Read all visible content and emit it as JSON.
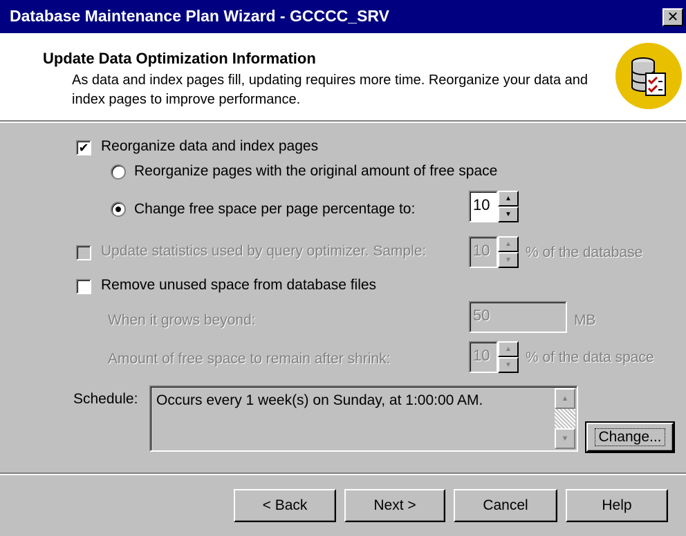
{
  "window": {
    "title": "Database Maintenance Plan Wizard - GCCCC_SRV",
    "close_glyph": "✕"
  },
  "header": {
    "title": "Update Data Optimization Information",
    "description": "As data and index pages fill, updating requires more time. Reorganize your data and index pages to improve performance.",
    "icon": "database-checklist-icon"
  },
  "options": {
    "reorganize": {
      "label": "Reorganize data and index pages",
      "checked": true,
      "enabled": true
    },
    "radio_original": {
      "label": "Reorganize pages with the original amount of free space",
      "selected": false
    },
    "radio_change": {
      "label": "Change free space per page percentage to:",
      "selected": true,
      "value": "10"
    },
    "update_stats": {
      "label": "Update statistics used by query optimizer. Sample:",
      "checked": false,
      "enabled": false,
      "value": "10",
      "suffix": "% of the database"
    },
    "remove_unused": {
      "label": "Remove unused space from database files",
      "checked": false,
      "enabled": true
    },
    "grows_beyond": {
      "label": "When it grows beyond:",
      "value": "50",
      "suffix": "MB",
      "enabled": false
    },
    "free_after_shrink": {
      "label": "Amount of free space to remain after shrink:",
      "value": "10",
      "suffix": "% of the data space",
      "enabled": false
    }
  },
  "schedule": {
    "label": "Schedule:",
    "text": "Occurs every 1 week(s) on Sunday, at 1:00:00 AM.",
    "change_label": "Change..."
  },
  "footer": {
    "back_label": "< Back",
    "next_label": "Next >",
    "cancel_label": "Cancel",
    "help_label": "Help"
  }
}
